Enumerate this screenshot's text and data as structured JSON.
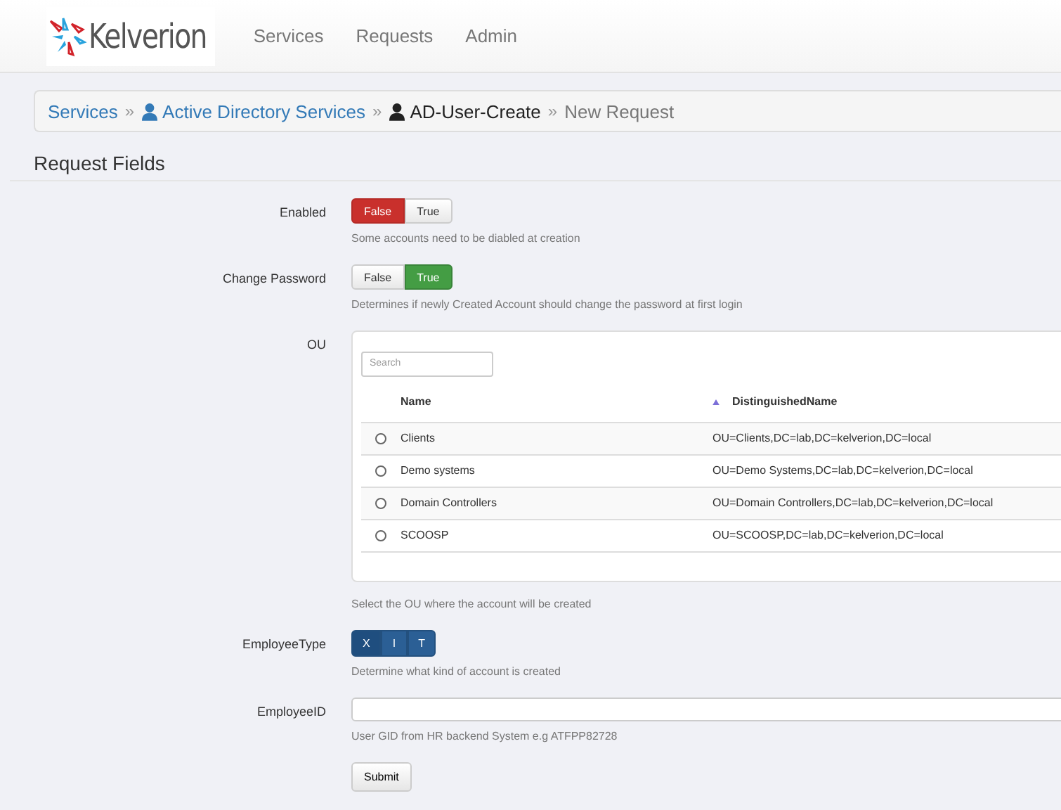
{
  "brand": "Kelverion",
  "nav": [
    "Services",
    "Requests",
    "Admin"
  ],
  "breadcrumb_separator": "»",
  "breadcrumb": [
    {
      "label": "Services",
      "kind": "link",
      "icon": false
    },
    {
      "label": "Active Directory Services",
      "kind": "link",
      "icon": true
    },
    {
      "label": "AD-User-Create",
      "kind": "current",
      "icon": true
    },
    {
      "label": "New Request",
      "kind": "plain",
      "icon": false
    }
  ],
  "section_title": "Request Fields",
  "fields": [
    {
      "kind": "toggle",
      "label": "Enabled",
      "options": [
        {
          "label": "False",
          "selected": true
        },
        {
          "label": "True",
          "selected": false
        }
      ],
      "help": "Some accounts need to be diabled at creation"
    },
    {
      "kind": "toggle",
      "label": "Change Password",
      "options": [
        {
          "label": "False",
          "selected": false
        },
        {
          "label": "True",
          "selected": true
        }
      ],
      "help": "Determines if newly Created Account should change the password at first login"
    },
    {
      "kind": "table",
      "label": "OU",
      "search": {
        "placeholder": "Search"
      },
      "columns": [
        "Name",
        "DistinguishedName"
      ],
      "rows": [
        {
          "name": "Clients",
          "dn": "OU=Clients,DC=lab,DC=kelverion,DC=local",
          "selected": false
        },
        {
          "name": "Demo systems",
          "dn": "OU=Demo Systems,DC=lab,DC=kelverion,DC=local",
          "selected": false
        },
        {
          "name": "Domain Controllers",
          "dn": "OU=Domain Controllers,DC=lab,DC=kelverion,DC=local",
          "selected": false
        },
        {
          "name": "SCOOSP",
          "dn": "OU=SCOOSP,DC=lab,DC=kelverion,DC=local",
          "selected": false
        }
      ],
      "help": "Select the OU where the account will be created"
    },
    {
      "kind": "segmented",
      "label": "EmployeeType",
      "options": [
        {
          "label": "X",
          "selected": true
        },
        {
          "label": "I",
          "selected": false
        },
        {
          "label": "T",
          "selected": false
        }
      ],
      "help": "Determine what kind of account is created"
    },
    {
      "kind": "input",
      "label": "EmployeeID",
      "help": "User GID from HR backend System e.g ATFPP82728"
    }
  ],
  "submit": "Submit"
}
